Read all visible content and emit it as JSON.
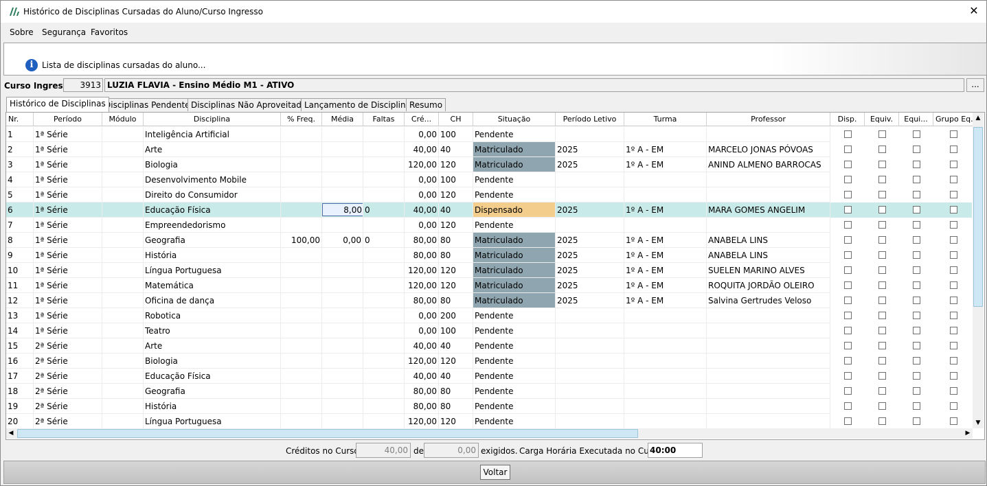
{
  "window": {
    "title": "Histórico de Disciplinas Cursadas do Aluno/Curso Ingresso",
    "close_glyph": "✕"
  },
  "menu": [
    {
      "label": "Sobre"
    },
    {
      "label": "Segurança"
    },
    {
      "label": "Favoritos"
    }
  ],
  "info": {
    "icon_glyph": "i",
    "text": "Lista de disciplinas cursadas do aluno..."
  },
  "course": {
    "label": "Curso Ingresso:",
    "code": "3913",
    "name": "LUZIA FLAVIA - Ensino Médio M1 - ATIVO",
    "more": "..."
  },
  "tabs": [
    {
      "label": "Histórico de Disciplinas",
      "active": true
    },
    {
      "label": "Disciplinas Pendentes"
    },
    {
      "label": "Disciplinas Não Aproveitadas"
    },
    {
      "label": "Lançamento de Disciplinas"
    },
    {
      "label": "Resumo"
    }
  ],
  "columns": [
    "Nr.",
    "Período",
    "Módulo",
    "Disciplina",
    "% Freq.",
    "Média",
    "Faltas",
    "Cré...",
    "CH",
    "Situação",
    "Período Letivo",
    "Turma",
    "Professor",
    "Disp.",
    "Equiv.",
    "Equi...",
    "Grupo Eq..."
  ],
  "rows": [
    {
      "nr": "1",
      "periodo": "1ª Série",
      "modulo": "",
      "disciplina": " Inteligência Artificial",
      "freq": "",
      "media": "",
      "faltas": "",
      "cred": "0,00",
      "ch": "100",
      "situacao": "Pendente",
      "letivo": "",
      "turma": "",
      "professor": ""
    },
    {
      "nr": "2",
      "periodo": "1ª Série",
      "modulo": "",
      "disciplina": "Arte",
      "freq": "",
      "media": "",
      "faltas": "",
      "cred": "40,00",
      "ch": "40",
      "situacao": "Matriculado",
      "letivo": "2025",
      "turma": "1º A - EM",
      "professor": "MARCELO JONAS PÓVOAS"
    },
    {
      "nr": "3",
      "periodo": "1ª Série",
      "modulo": "",
      "disciplina": "Biologia",
      "freq": "",
      "media": "",
      "faltas": "",
      "cred": "120,00",
      "ch": "120",
      "situacao": "Matriculado",
      "letivo": "2025",
      "turma": "1º A - EM",
      "professor": "ANIND ALMENO BARROCAS"
    },
    {
      "nr": "4",
      "periodo": "1ª Série",
      "modulo": "",
      "disciplina": "Desenvolvimento Mobile",
      "freq": "",
      "media": "",
      "faltas": "",
      "cred": "0,00",
      "ch": "100",
      "situacao": "Pendente",
      "letivo": "",
      "turma": "",
      "professor": ""
    },
    {
      "nr": "5",
      "periodo": "1ª Série",
      "modulo": "",
      "disciplina": "Direito do Consumidor",
      "freq": "",
      "media": "",
      "faltas": "",
      "cred": "0,00",
      "ch": "120",
      "situacao": "Pendente",
      "letivo": "",
      "turma": "",
      "professor": ""
    },
    {
      "nr": "6",
      "periodo": "1ª Série",
      "modulo": "",
      "disciplina": "Educação Física",
      "freq": "",
      "media": "8,00",
      "faltas": "0",
      "cred": "40,00",
      "ch": "40",
      "situacao": "Dispensado",
      "letivo": "2025",
      "turma": "1º A - EM",
      "professor": "MARA GOMES ANGELIM",
      "selected": true
    },
    {
      "nr": "7",
      "periodo": "1ª Série",
      "modulo": "",
      "disciplina": "Empreendedorismo",
      "freq": "",
      "media": "",
      "faltas": "",
      "cred": "0,00",
      "ch": "120",
      "situacao": "Pendente",
      "letivo": "",
      "turma": "",
      "professor": ""
    },
    {
      "nr": "8",
      "periodo": "1ª Série",
      "modulo": "",
      "disciplina": "Geografia",
      "freq": "100,00",
      "media": "0,00",
      "faltas": "0",
      "cred": "80,00",
      "ch": "80",
      "situacao": "Matriculado",
      "letivo": "2025",
      "turma": "1º A - EM",
      "professor": "ANABELA LINS"
    },
    {
      "nr": "9",
      "periodo": "1ª Série",
      "modulo": "",
      "disciplina": "História",
      "freq": "",
      "media": "",
      "faltas": "",
      "cred": "80,00",
      "ch": "80",
      "situacao": "Matriculado",
      "letivo": "2025",
      "turma": "1º A - EM",
      "professor": "ANABELA LINS"
    },
    {
      "nr": "10",
      "periodo": "1ª Série",
      "modulo": "",
      "disciplina": "Língua Portuguesa",
      "freq": "",
      "media": "",
      "faltas": "",
      "cred": "120,00",
      "ch": "120",
      "situacao": "Matriculado",
      "letivo": "2025",
      "turma": "1º A - EM",
      "professor": "SUELEN MARINO ALVES"
    },
    {
      "nr": "11",
      "periodo": "1ª Série",
      "modulo": "",
      "disciplina": "Matemática",
      "freq": "",
      "media": "",
      "faltas": "",
      "cred": "120,00",
      "ch": "120",
      "situacao": "Matriculado",
      "letivo": "2025",
      "turma": "1º A - EM",
      "professor": "ROQUITA JORDÃO OLEIRO"
    },
    {
      "nr": "12",
      "periodo": "1ª Série",
      "modulo": "",
      "disciplina": "Oficina de dança",
      "freq": "",
      "media": "",
      "faltas": "",
      "cred": "80,00",
      "ch": "80",
      "situacao": "Matriculado",
      "letivo": "2025",
      "turma": "1º A - EM",
      "professor": "Salvina Gertrudes Veloso"
    },
    {
      "nr": "13",
      "periodo": "1ª Série",
      "modulo": "",
      "disciplina": "Robotica",
      "freq": "",
      "media": "",
      "faltas": "",
      "cred": "0,00",
      "ch": "200",
      "situacao": "Pendente",
      "letivo": "",
      "turma": "",
      "professor": ""
    },
    {
      "nr": "14",
      "periodo": "1ª Série",
      "modulo": "",
      "disciplina": "Teatro",
      "freq": "",
      "media": "",
      "faltas": "",
      "cred": "0,00",
      "ch": "100",
      "situacao": "Pendente",
      "letivo": "",
      "turma": "",
      "professor": ""
    },
    {
      "nr": "15",
      "periodo": "2ª Série",
      "modulo": "",
      "disciplina": "Arte",
      "freq": "",
      "media": "",
      "faltas": "",
      "cred": "40,00",
      "ch": "40",
      "situacao": "Pendente",
      "letivo": "",
      "turma": "",
      "professor": ""
    },
    {
      "nr": "16",
      "periodo": "2ª Série",
      "modulo": "",
      "disciplina": "Biologia",
      "freq": "",
      "media": "",
      "faltas": "",
      "cred": "120,00",
      "ch": "120",
      "situacao": "Pendente",
      "letivo": "",
      "turma": "",
      "professor": ""
    },
    {
      "nr": "17",
      "periodo": "2ª Série",
      "modulo": "",
      "disciplina": "Educação Física",
      "freq": "",
      "media": "",
      "faltas": "",
      "cred": "40,00",
      "ch": "40",
      "situacao": "Pendente",
      "letivo": "",
      "turma": "",
      "professor": ""
    },
    {
      "nr": "18",
      "periodo": "2ª Série",
      "modulo": "",
      "disciplina": "Geografia",
      "freq": "",
      "media": "",
      "faltas": "",
      "cred": "80,00",
      "ch": "80",
      "situacao": "Pendente",
      "letivo": "",
      "turma": "",
      "professor": ""
    },
    {
      "nr": "19",
      "periodo": "2ª Série",
      "modulo": "",
      "disciplina": "História",
      "freq": "",
      "media": "",
      "faltas": "",
      "cred": "80,00",
      "ch": "80",
      "situacao": "Pendente",
      "letivo": "",
      "turma": "",
      "professor": ""
    },
    {
      "nr": "20",
      "periodo": "2ª Série",
      "modulo": "",
      "disciplina": "Língua Portuguesa",
      "freq": "",
      "media": "",
      "faltas": "",
      "cred": "120,00",
      "ch": "120",
      "situacao": "Pendente",
      "letivo": "",
      "turma": "",
      "professor": ""
    }
  ],
  "colors": {
    "matriculado": "#8fa6b0",
    "dispensado": "#f3cd8c",
    "selected_row": "#c8eae9"
  },
  "footer": {
    "creditos_label": "Créditos no Curso:",
    "creditos_value": "40,00",
    "de_label": "de",
    "exigidos_value": "0,00",
    "exigidos_label": "exigidos.",
    "carga_label": "Carga Horária Executada no Curso:",
    "carga_value": "40:00"
  },
  "buttons": {
    "voltar": "Voltar"
  }
}
